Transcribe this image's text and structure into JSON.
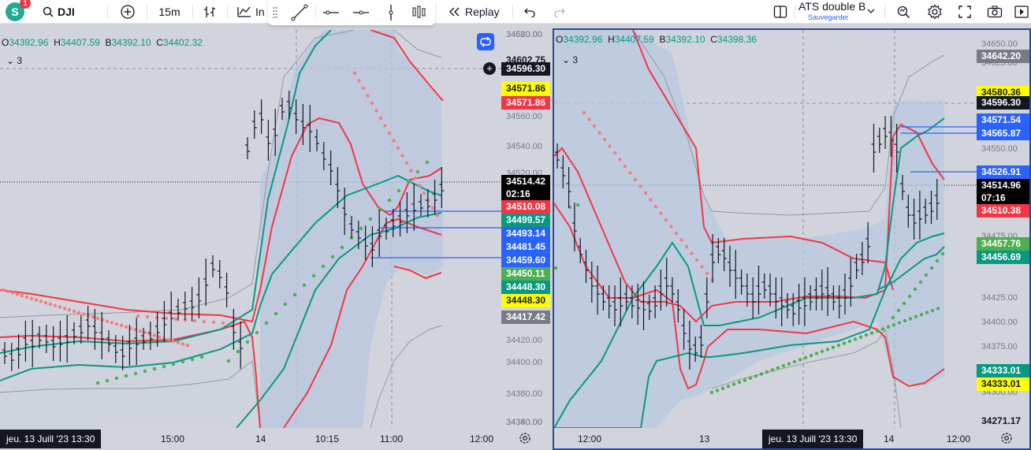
{
  "toolbar": {
    "avatar_letter": "S",
    "notifications": "1",
    "symbol": "DJI",
    "interval": "15m",
    "indicators_label": "In",
    "replay_label": "Replay",
    "layout_name": "ATS double B",
    "layout_save": "Sauvegarder"
  },
  "left_pane": {
    "legend": {
      "o": "34392.96",
      "h": "34407.59",
      "b": "34392.10",
      "c": "34402.32"
    },
    "collapsed_count": "3",
    "price_ticks": [
      "34620.00",
      "34580.00",
      "34560.00",
      "34540.00",
      "34520.00",
      "34420.00",
      "34400.00",
      "34380.00",
      "34360.00",
      "34340.00"
    ],
    "labels": [
      {
        "text": "34602.75",
        "bg": "#d1d4dc",
        "fg": "#131722"
      },
      {
        "text": "34596.30",
        "bg": "#131722",
        "fg": "#ffffff"
      },
      {
        "text": "34571.86",
        "bg": "#ffff00",
        "fg": "#131722"
      },
      {
        "text": "34571.86",
        "bg": "#f23645",
        "fg": "#ffffff"
      },
      {
        "text": "34514.42",
        "sub": "02:16",
        "bg": "#000000",
        "fg": "#ffffff"
      },
      {
        "text": "34510.08",
        "bg": "#f23645",
        "fg": "#ffffff"
      },
      {
        "text": "34499.57",
        "bg": "#089981",
        "fg": "#ffffff"
      },
      {
        "text": "34493.14",
        "bg": "#2962ff",
        "fg": "#ffffff"
      },
      {
        "text": "34481.45",
        "bg": "#2962ff",
        "fg": "#ffffff"
      },
      {
        "text": "34459.60",
        "bg": "#2962ff",
        "fg": "#ffffff"
      },
      {
        "text": "34450.11",
        "bg": "#4caf50",
        "fg": "#ffffff"
      },
      {
        "text": "34448.30",
        "bg": "#089981",
        "fg": "#ffffff"
      },
      {
        "text": "34448.30",
        "bg": "#ffff00",
        "fg": "#131722"
      },
      {
        "text": "34417.42",
        "bg": "#787b86",
        "fg": "#ffffff"
      }
    ],
    "time_labels": [
      "15:00",
      "14",
      "10:15",
      "11:00",
      "12:00"
    ],
    "date_badge": "jeu. 13 Juill '23   13:30"
  },
  "right_pane": {
    "legend": {
      "o": "34392.96",
      "h": "34407.59",
      "b": "34392.10",
      "c": "34398.36"
    },
    "collapsed_count": "3",
    "price_ticks": [
      "34650.00",
      "34625.00",
      "34550.00",
      "34475.00",
      "34425.00",
      "34400.00",
      "34375.00",
      "34350.00",
      "34300.00"
    ],
    "labels": [
      {
        "text": "34642.20",
        "bg": "#787b86",
        "fg": "#ffffff"
      },
      {
        "text": "34580.36",
        "bg": "#ffff00",
        "fg": "#131722"
      },
      {
        "text": "34596.30",
        "bg": "#131722",
        "fg": "#ffffff"
      },
      {
        "text": "34571.54",
        "bg": "#2962ff",
        "fg": "#ffffff"
      },
      {
        "text": "34565.87",
        "bg": "#2962ff",
        "fg": "#ffffff"
      },
      {
        "text": "34526.91",
        "bg": "#2962ff",
        "fg": "#ffffff"
      },
      {
        "text": "34514.96",
        "sub": "07:16",
        "bg": "#000000",
        "fg": "#ffffff"
      },
      {
        "text": "34510.38",
        "bg": "#f23645",
        "fg": "#ffffff"
      },
      {
        "text": "34457.76",
        "bg": "#4caf50",
        "fg": "#ffffff"
      },
      {
        "text": "34456.69",
        "bg": "#089981",
        "fg": "#ffffff"
      },
      {
        "text": "34333.01",
        "bg": "#089981",
        "fg": "#ffffff"
      },
      {
        "text": "34333.01",
        "bg": "#ffff00",
        "fg": "#131722"
      },
      {
        "text": "34271.17",
        "bg": "#d1d4dc",
        "fg": "#131722"
      }
    ],
    "time_labels": [
      "12:00",
      "13",
      "14",
      "12:00"
    ],
    "date_badge": "jeu. 13 Juill '23   13:30"
  },
  "colors": {
    "upper_band": "#f23645",
    "lower_band": "#089981",
    "shade": "#b8c7e0",
    "psar_up": "#f77c80",
    "psar_down": "#4caf50",
    "level_line": "#2962ff"
  },
  "icons": [
    "plus-circle-icon",
    "bar-style-icon",
    "indicators-icon",
    "trendline-icon",
    "horizontal-line-icon",
    "horizontal-ray-icon",
    "vertical-line-icon",
    "bar-pattern-icon",
    "replay-icon",
    "undo-icon",
    "redo-icon",
    "layout-icon",
    "alert-icon",
    "settings-icon",
    "fullscreen-icon",
    "camera-icon",
    "publish-icon",
    "sync-icon",
    "tradingview-logo-icon"
  ]
}
